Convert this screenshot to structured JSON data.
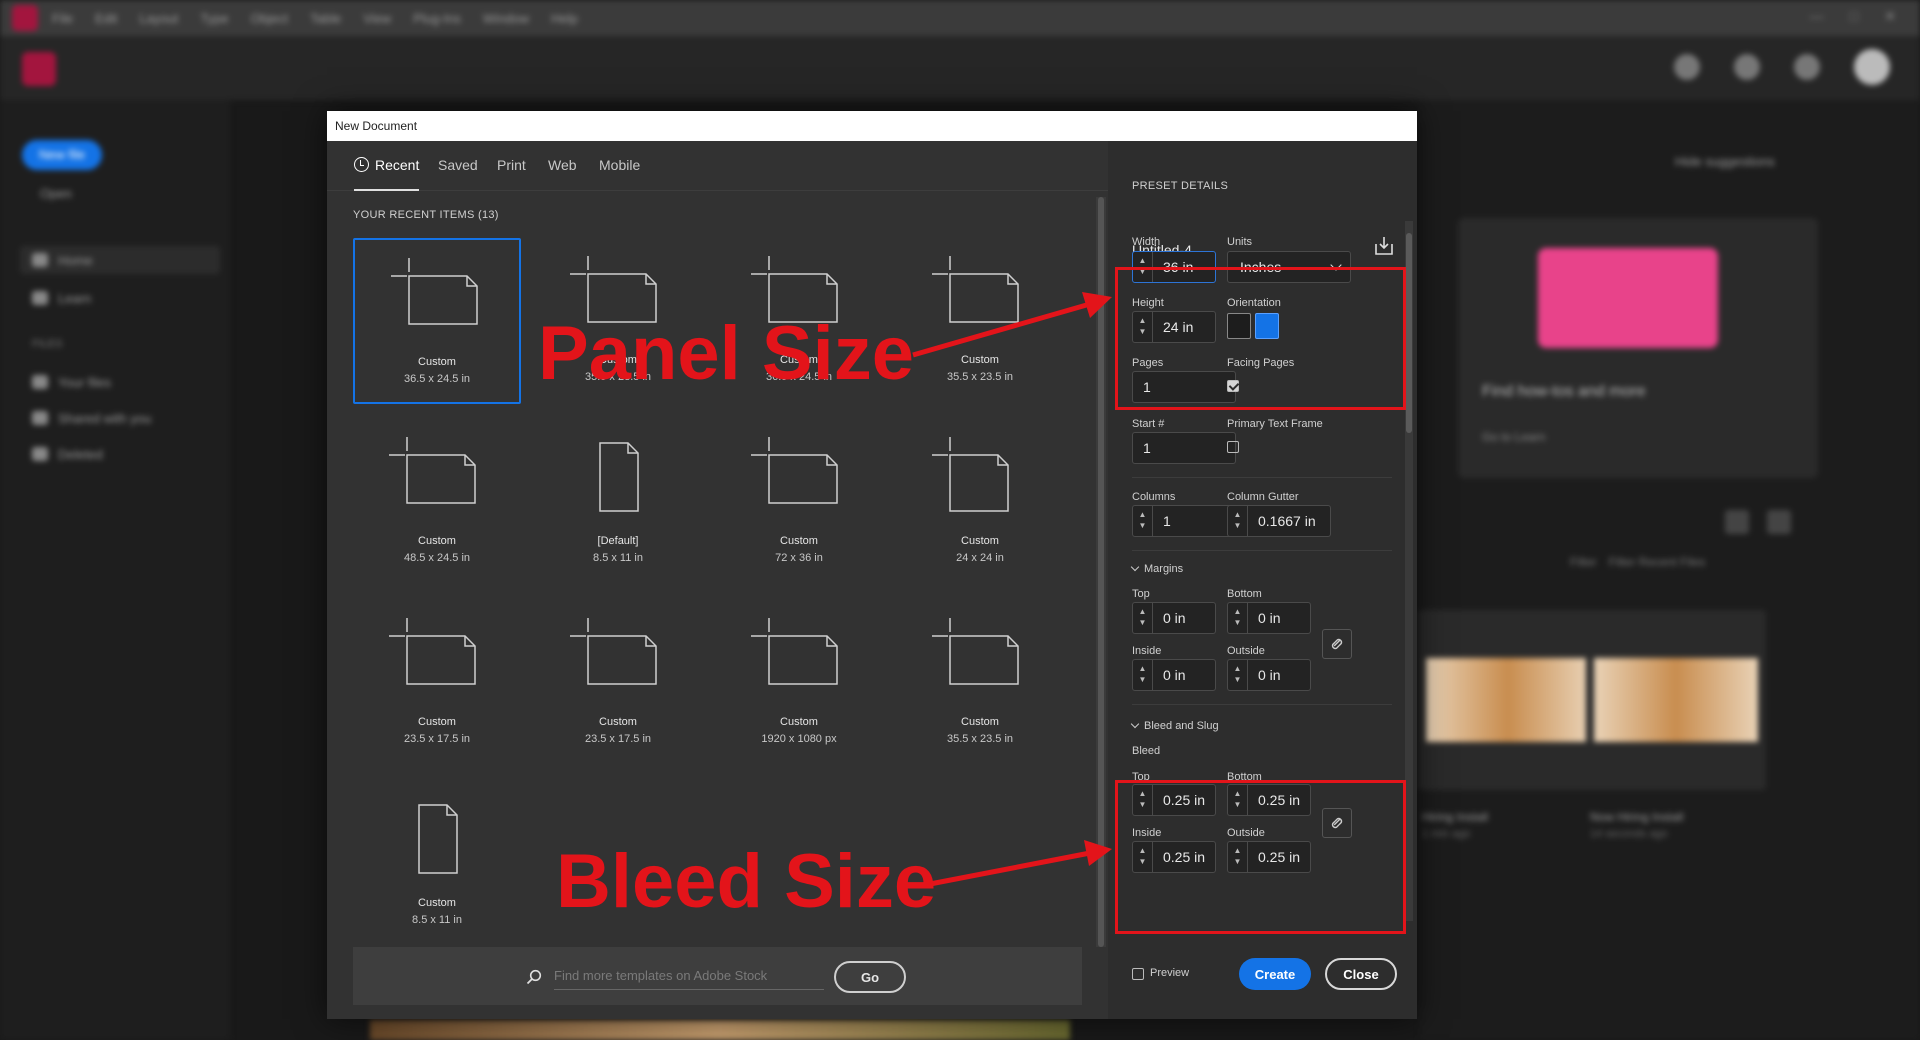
{
  "menubar": {
    "items": [
      "File",
      "Edit",
      "Layout",
      "Type",
      "Object",
      "Table",
      "View",
      "Plug-Ins",
      "Window",
      "Help"
    ]
  },
  "home": {
    "new_file": "New file",
    "open": "Open",
    "nav": [
      "Home",
      "Learn"
    ],
    "files_head": "FILES",
    "files_nav": [
      "Your files",
      "Shared with you",
      "Deleted"
    ],
    "hide_suggestions": "Hide suggestions",
    "promo_title": "Find how-tos and more",
    "promo_link": "Go to Learn",
    "filter_label": "Filter",
    "filter_placeholder": "Filter Recent Files",
    "files": [
      {
        "name": "Hiring Install",
        "date": "1 min ago"
      },
      {
        "name": "Now Hiring Install",
        "date": "14 seconds ago"
      }
    ]
  },
  "dialog": {
    "title": "New Document",
    "tabs": [
      "Recent",
      "Saved",
      "Print",
      "Web",
      "Mobile"
    ],
    "active_tab": "Recent",
    "recent_heading": "YOUR RECENT ITEMS",
    "recent_count": "(13)",
    "items": [
      {
        "name": "Custom",
        "size": "36.5 x 24.5 in",
        "shape": "landscape"
      },
      {
        "name": "Custom",
        "size": "35.5 x 23.5 in",
        "shape": "landscape"
      },
      {
        "name": "Custom",
        "size": "36.5 x 24.5 in",
        "shape": "landscape"
      },
      {
        "name": "Custom",
        "size": "35.5 x 23.5 in",
        "shape": "landscape"
      },
      {
        "name": "Custom",
        "size": "48.5 x 24.5 in",
        "shape": "landscape"
      },
      {
        "name": "[Default]",
        "size": "8.5 x 11 in",
        "shape": "portrait"
      },
      {
        "name": "Custom",
        "size": "72 x 36 in",
        "shape": "landscape"
      },
      {
        "name": "Custom",
        "size": "24 x 24 in",
        "shape": "square"
      },
      {
        "name": "Custom",
        "size": "23.5 x 17.5 in",
        "shape": "landscape"
      },
      {
        "name": "Custom",
        "size": "23.5 x 17.5 in",
        "shape": "landscape"
      },
      {
        "name": "Custom",
        "size": "1920 x 1080 px",
        "shape": "landscape"
      },
      {
        "name": "Custom",
        "size": "35.5 x 23.5 in",
        "shape": "landscape"
      },
      {
        "name": "Custom",
        "size": "8.5 x 11 in",
        "shape": "portrait"
      }
    ],
    "search_placeholder": "Find more templates on Adobe Stock",
    "go_label": "Go"
  },
  "details": {
    "heading": "PRESET DETAILS",
    "doc_name": "Untitled-4",
    "width_label": "Width",
    "width_value": "36 in",
    "units_label": "Units",
    "units_value": "Inches",
    "height_label": "Height",
    "height_value": "24 in",
    "orientation_label": "Orientation",
    "pages_label": "Pages",
    "pages_value": "1",
    "facing_label": "Facing Pages",
    "facing_checked": true,
    "start_label": "Start #",
    "start_value": "1",
    "ptf_label": "Primary Text Frame",
    "ptf_checked": false,
    "columns_label": "Columns",
    "columns_value": "1",
    "gutter_label": "Column Gutter",
    "gutter_value": "0.1667 in",
    "margins": {
      "heading": "Margins",
      "top_label": "Top",
      "top": "0 in",
      "bottom_label": "Bottom",
      "bottom": "0 in",
      "inside_label": "Inside",
      "inside": "0 in",
      "outside_label": "Outside",
      "outside": "0 in"
    },
    "bleed": {
      "heading": "Bleed and Slug",
      "sub": "Bleed",
      "top_label": "Top",
      "top": "0.25 in",
      "bottom_label": "Bottom",
      "bottom": "0.25 in",
      "inside_label": "Inside",
      "inside": "0.25 in",
      "outside_label": "Outside",
      "outside": "0.25 in"
    },
    "preview_label": "Preview",
    "create_label": "Create",
    "close_label": "Close"
  },
  "annotations": {
    "panel_size": "Panel Size",
    "bleed_size": "Bleed Size",
    "color": "#e3141a"
  }
}
